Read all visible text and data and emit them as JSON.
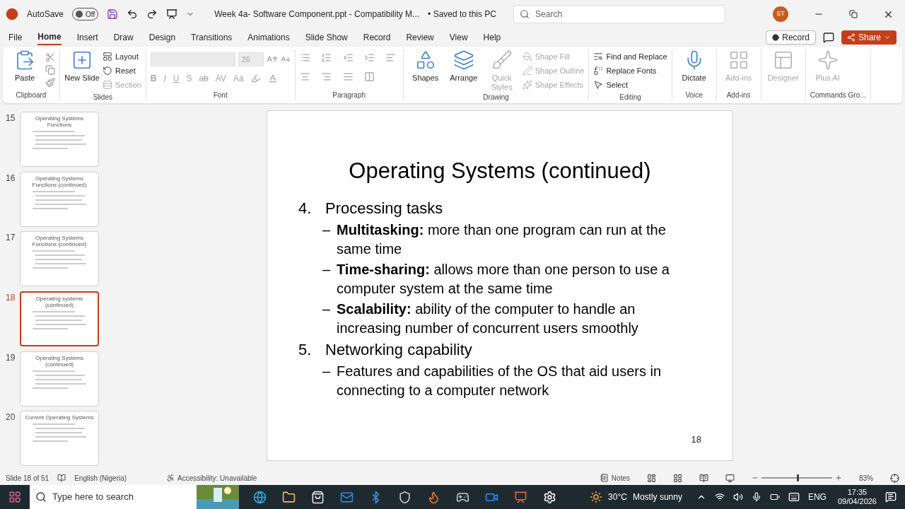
{
  "title_bar": {
    "autosave_label": "AutoSave",
    "autosave": {
      "on": false,
      "label": "Off"
    },
    "document": "Week 4a- Software Component.ppt  -  Compatibility M...",
    "save_status": "• Saved to this PC",
    "search": {
      "placeholder": "Search"
    },
    "avatar": "ST"
  },
  "menu_tabs": [
    {
      "label": "File",
      "selected": false
    },
    {
      "label": "Home",
      "selected": true
    },
    {
      "label": "Insert",
      "selected": false
    },
    {
      "label": "Draw",
      "selected": false
    },
    {
      "label": "Design",
      "selected": false
    },
    {
      "label": "Transitions",
      "selected": false
    },
    {
      "label": "Animations",
      "selected": false
    },
    {
      "label": "Slide Show",
      "selected": false
    },
    {
      "label": "Record",
      "selected": false
    },
    {
      "label": "Review",
      "selected": false
    },
    {
      "label": "View",
      "selected": false
    },
    {
      "label": "Help",
      "selected": false
    }
  ],
  "record_button": "Record",
  "share_button": "Share",
  "ribbon": [
    {
      "kind": "buttons",
      "label": "Clipboard",
      "items": [
        {
          "label": "Paste",
          "kind": "large",
          "disabled": false
        }
      ]
    },
    {
      "kind": "buttons",
      "label": "Slides",
      "items": [
        {
          "label": "New Slide",
          "kind": "large",
          "disabled": false
        },
        {
          "label": "Layout",
          "kind": "small",
          "disabled": false
        },
        {
          "label": "Reset",
          "kind": "small",
          "disabled": false
        },
        {
          "label": "Section",
          "kind": "small",
          "disabled": true
        }
      ]
    },
    {
      "kind": "font",
      "label": "Font",
      "font_size": "26",
      "format_buttons": [
        "B",
        "I",
        "U",
        "S",
        "ab",
        "AV",
        "Aa"
      ]
    },
    {
      "kind": "paragraph",
      "label": "Paragraph"
    },
    {
      "kind": "buttons",
      "label": "Drawing",
      "items": [
        {
          "label": "Shapes",
          "kind": "large",
          "disabled": false
        },
        {
          "label": "Arrange",
          "kind": "large",
          "disabled": false
        },
        {
          "label": "Quick Styles",
          "kind": "large",
          "disabled": true
        },
        {
          "label": "Shape Fill",
          "kind": "small",
          "disabled": true
        },
        {
          "label": "Shape Outline",
          "kind": "small",
          "disabled": true
        },
        {
          "label": "Shape Effects",
          "kind": "small",
          "disabled": true
        }
      ]
    },
    {
      "kind": "buttons",
      "label": "Editing",
      "items": [
        {
          "label": "Find and Replace",
          "kind": "small",
          "disabled": false
        },
        {
          "label": "Replace Fonts",
          "kind": "small",
          "disabled": false
        },
        {
          "label": "Select",
          "kind": "small",
          "disabled": false
        }
      ]
    },
    {
      "kind": "buttons",
      "label": "Voice",
      "items": [
        {
          "label": "Dictate",
          "kind": "large",
          "disabled": false
        }
      ]
    },
    {
      "kind": "buttons",
      "label": "Add-ins",
      "items": [
        {
          "label": "Add-ins",
          "kind": "large",
          "disabled": true
        }
      ]
    },
    {
      "kind": "buttons",
      "items": [
        {
          "label": "Designer",
          "kind": "large",
          "disabled": true
        }
      ]
    },
    {
      "kind": "buttons",
      "label": "Commands Gro...",
      "items": [
        {
          "label": "Plus AI",
          "kind": "large",
          "disabled": true
        }
      ]
    }
  ],
  "thumbnails": [
    {
      "number": "15",
      "title": "Operating Systems Functions",
      "selected": false
    },
    {
      "number": "16",
      "title": "Operating Systems Functions (continued)",
      "selected": false
    },
    {
      "number": "17",
      "title": "Operating Systems Functions (continued)",
      "selected": false
    },
    {
      "number": "18",
      "title": "Operating systems (continued)",
      "selected": true
    },
    {
      "number": "19",
      "title": "Operating Systems (continued)",
      "selected": false
    },
    {
      "number": "20",
      "title": "Current Operating Systems",
      "selected": false
    }
  ],
  "slide": {
    "title": "Operating Systems (continued)",
    "items": [
      {
        "number": "4.",
        "text": "Processing tasks",
        "children": [
          {
            "marker": "–",
            "text": "**Multitasking:** more than one program can run at the same time"
          },
          {
            "marker": "–",
            "text": "**Time-sharing:** allows more than one person to use a computer system at the same time"
          },
          {
            "marker": "–",
            "text": "**Scalability:** ability of the computer to handle an increasing number of concurrent users smoothly"
          }
        ]
      },
      {
        "number": "5.",
        "text": "Networking capability",
        "children": [
          {
            "marker": "–",
            "text": "Features and capabilities of the OS that aid users in connecting to a computer network"
          }
        ]
      }
    ],
    "page_number": "18"
  },
  "status_bar": {
    "slide_position": "Slide 18 of 51",
    "language": "English (Nigeria)",
    "accessibility": "Accessibility: Unavailable",
    "notes": "Notes",
    "zoom": {
      "level": 0.5,
      "reading": "83%"
    }
  },
  "taskbar": {
    "search": {
      "placeholder": "Type here to search"
    },
    "temperature": "30°C",
    "weather": "Mostly sunny",
    "language": "ENG",
    "time": "17:35",
    "date": "09/04/2026"
  }
}
